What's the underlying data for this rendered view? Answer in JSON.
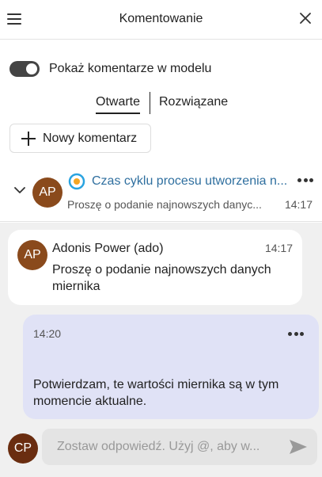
{
  "header": {
    "title": "Komentowanie"
  },
  "toggle": {
    "label": "Pokaż komentarze w modelu",
    "enabled": true
  },
  "tabs": [
    {
      "label": "Otwarte",
      "active": true
    },
    {
      "label": "Rozwiązane",
      "active": false
    }
  ],
  "new_comment": {
    "label": "Nowy komentarz"
  },
  "thread": {
    "avatar_initials": "AP",
    "title": "Czas cyklu procesu utworzenia n...",
    "preview": "Proszę o podanie najnowszych danyc...",
    "time": "14:17",
    "expanded": true
  },
  "messages": [
    {
      "avatar_initials": "AP",
      "author": "Adonis Power (ado)",
      "time": "14:17",
      "text": "Proszę o podanie najnowszych danych miernika"
    }
  ],
  "reply": {
    "time": "14:20",
    "text": "Potwierdzam, te wartości miernika są w tym momencie aktualne."
  },
  "composer": {
    "avatar_initials": "CP",
    "placeholder": "Zostaw odpowiedź. Użyj @, aby w..."
  },
  "icons": {
    "menu": "hamburger-menu-icon",
    "close": "close-icon",
    "plus": "plus-icon",
    "chevron": "chevron-down-icon",
    "target": "target-icon",
    "more": "more-dots-icon",
    "send": "send-icon"
  },
  "colors": {
    "avatar_ap": "#8a4a1c",
    "avatar_cp": "#6a2d10",
    "thread_title": "#2f6f9f",
    "reply_bubble": "#e0e2f6",
    "conversation_bg": "#f0f0f0",
    "target_ring": "#29a3e0",
    "target_center": "#f5a623"
  }
}
